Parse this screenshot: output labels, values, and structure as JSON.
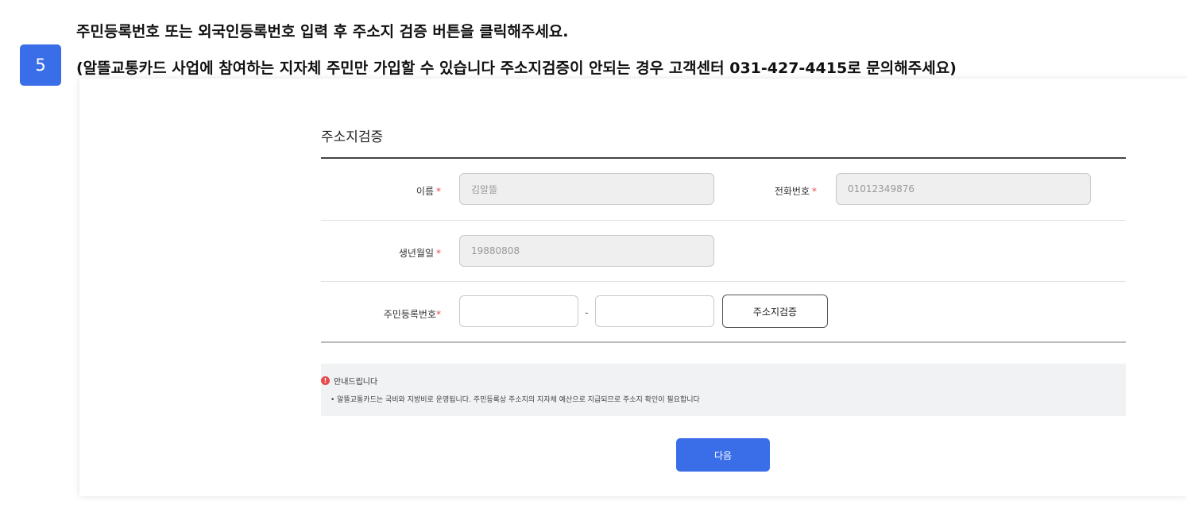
{
  "step": {
    "number": "5"
  },
  "instruction": {
    "line1": "주민등록번호 또는 외국인등록번호 입력 후 주소지 검증 버튼을 클릭해주세요.",
    "line2": "(알뜰교통카드 사업에 참여하는 지자체 주민만 가입할 수 있습니다 주소지검증이 안되는 경우 고객센터 031-427-4415로 문의해주세요)"
  },
  "form": {
    "title": "주소지검증",
    "required_mark": "*",
    "name": {
      "label": "이름",
      "value": "김알뜰"
    },
    "phone": {
      "label": "전화번호",
      "value": "01012349876"
    },
    "birth": {
      "label": "생년월일",
      "value": "19880808"
    },
    "rrn": {
      "label": "주민등록번호",
      "separator": "-",
      "front_value": "",
      "back_value": ""
    },
    "verify_button": "주소지검증"
  },
  "notice": {
    "icon": "alert-circle-icon",
    "title": "안내드립니다",
    "body": "• 알뜰교통카드는 국비와 지방비로 운영됩니다. 주민등록상 주소지의 지자체 예산으로 지급되므로 주소지 확인이 필요합니다"
  },
  "next_button": "다음",
  "colors": {
    "accent": "#3a6ee8",
    "required": "#e84b4b"
  }
}
